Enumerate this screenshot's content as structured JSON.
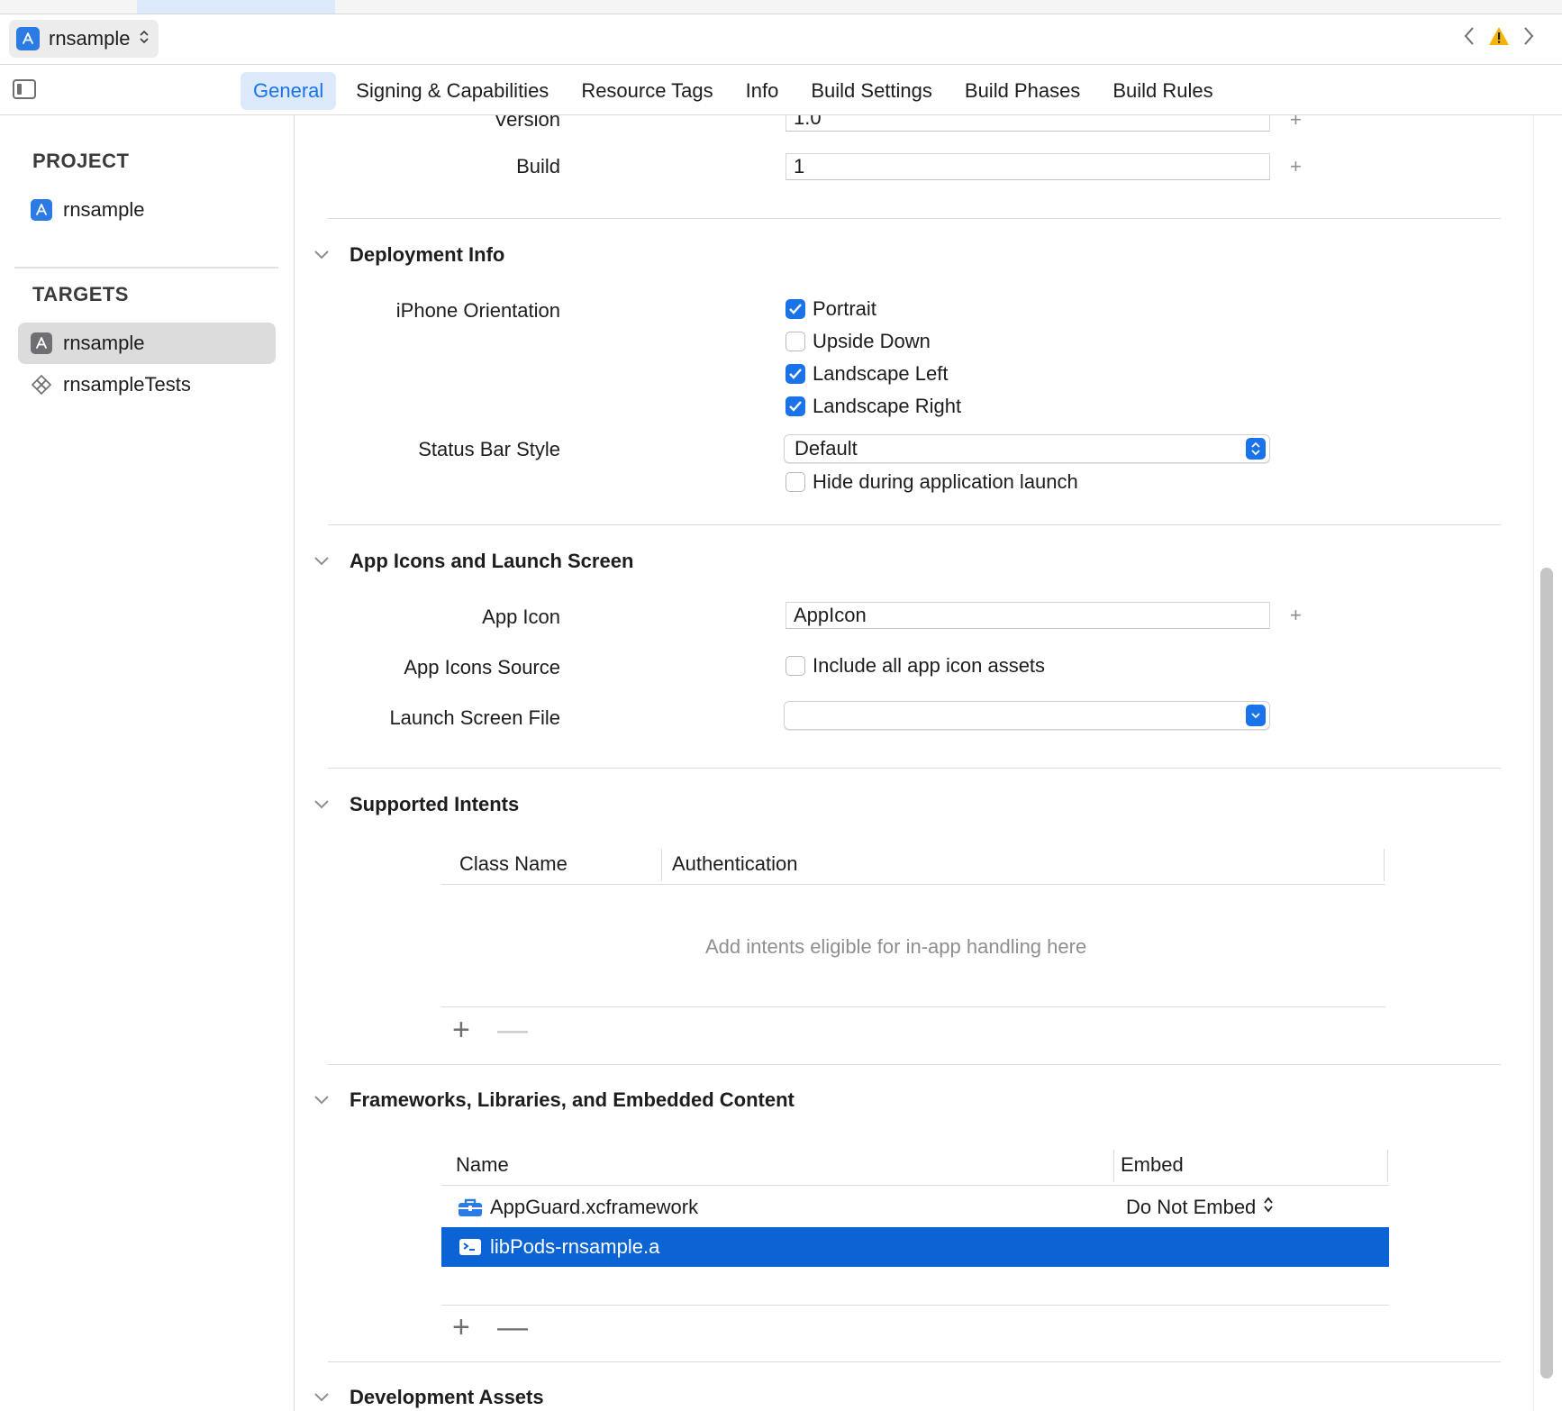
{
  "scheme": {
    "name": "rnsample"
  },
  "tabs": [
    {
      "label": "General",
      "active": true
    },
    {
      "label": "Signing & Capabilities"
    },
    {
      "label": "Resource Tags"
    },
    {
      "label": "Info"
    },
    {
      "label": "Build Settings"
    },
    {
      "label": "Build Phases"
    },
    {
      "label": "Build Rules"
    }
  ],
  "sidebar": {
    "project_title": "PROJECT",
    "project_item": "rnsample",
    "targets_title": "TARGETS",
    "targets": [
      {
        "label": "rnsample",
        "selected": true
      },
      {
        "label": "rnsampleTests"
      }
    ]
  },
  "identity": {
    "version_label": "Version",
    "version_value": "1.0",
    "build_label": "Build",
    "build_value": "1"
  },
  "deployment": {
    "title": "Deployment Info",
    "orientation_label": "iPhone Orientation",
    "orientations": [
      {
        "label": "Portrait",
        "checked": true
      },
      {
        "label": "Upside Down",
        "checked": false
      },
      {
        "label": "Landscape Left",
        "checked": true
      },
      {
        "label": "Landscape Right",
        "checked": true
      }
    ],
    "status_bar_label": "Status Bar Style",
    "status_bar_value": "Default",
    "hide_label": "Hide during application launch",
    "hide_checked": false
  },
  "app_icons": {
    "title": "App Icons and Launch Screen",
    "app_icon_label": "App Icon",
    "app_icon_value": "AppIcon",
    "source_label": "App Icons Source",
    "source_option": "Include all app icon assets",
    "source_checked": false,
    "launch_label": "Launch Screen File",
    "launch_value": ""
  },
  "intents": {
    "title": "Supported Intents",
    "col_class": "Class Name",
    "col_auth": "Authentication",
    "empty_message": "Add intents eligible for in-app handling here",
    "add": "+",
    "remove": "—"
  },
  "frameworks": {
    "title": "Frameworks, Libraries, and Embedded Content",
    "col_name": "Name",
    "col_embed": "Embed",
    "items": [
      {
        "name": "AppGuard.xcframework",
        "embed": "Do Not Embed",
        "selected": false
      },
      {
        "name": "libPods-rnsample.a",
        "embed": "",
        "selected": true
      }
    ],
    "add": "+",
    "remove": "—"
  },
  "dev_assets": {
    "title": "Development Assets"
  },
  "colors": {
    "accent": "#1a73e8",
    "selection": "#0b63d4",
    "warning": "#f5b400"
  }
}
